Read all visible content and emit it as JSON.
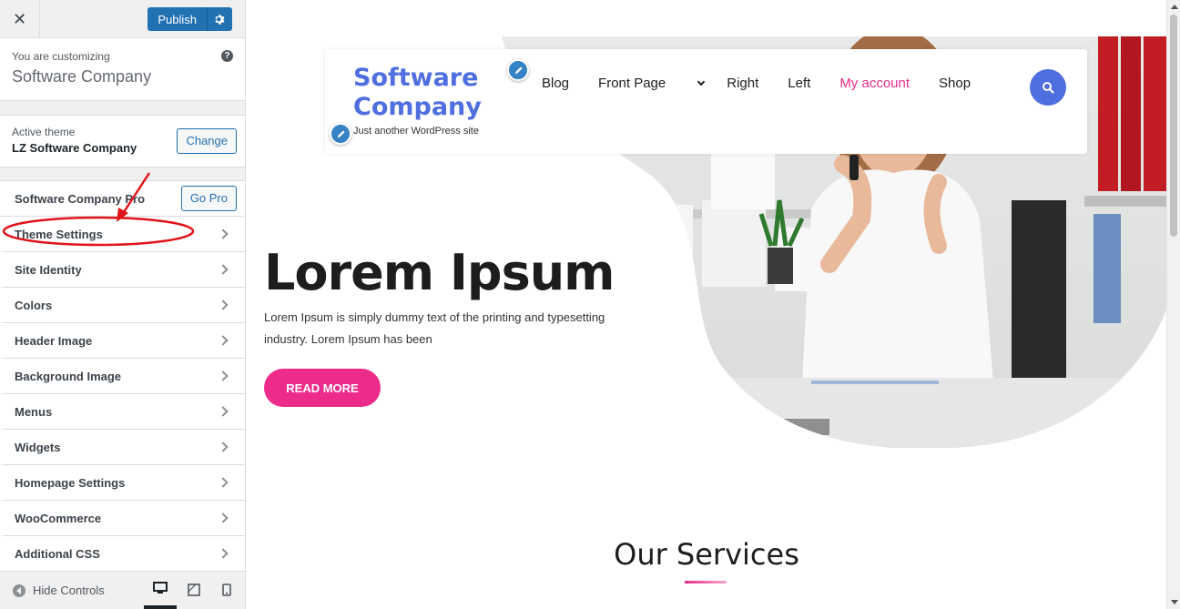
{
  "sidebar": {
    "close_label": "✕",
    "publish_label": "Publish",
    "customizing_small": "You are customizing",
    "customizing_site": "Software Company",
    "help_label": "?",
    "active_theme_small": "Active theme",
    "active_theme_name": "LZ Software Company",
    "change_label": "Change",
    "pro_label": "Software Company Pro",
    "gopro_label": "Go Pro",
    "sections": [
      "Theme Settings",
      "Site Identity",
      "Colors",
      "Header Image",
      "Background Image",
      "Menus",
      "Widgets",
      "Homepage Settings",
      "WooCommerce",
      "Additional CSS"
    ],
    "hide_controls_label": "Hide Controls"
  },
  "preview": {
    "logo_line1": "Software",
    "logo_line2": "Company",
    "tagline": "Just another WordPress site",
    "nav": [
      "Blog",
      "Front Page",
      "Right",
      "Left",
      "My account",
      "Shop"
    ],
    "active_nav_color": "#ec2b8a",
    "hero_title": "Lorem Ipsum",
    "hero_text": "Lorem Ipsum is simply dummy text of the printing and typesetting industry. Lorem Ipsum has been",
    "read_more_label": "READ MORE",
    "services_title": "Our Services"
  },
  "colors": {
    "wp_blue": "#2271b1",
    "brand_blue": "#4f6fe0",
    "brand_pink": "#ec2b8a",
    "annotation_red": "#e0141a"
  }
}
